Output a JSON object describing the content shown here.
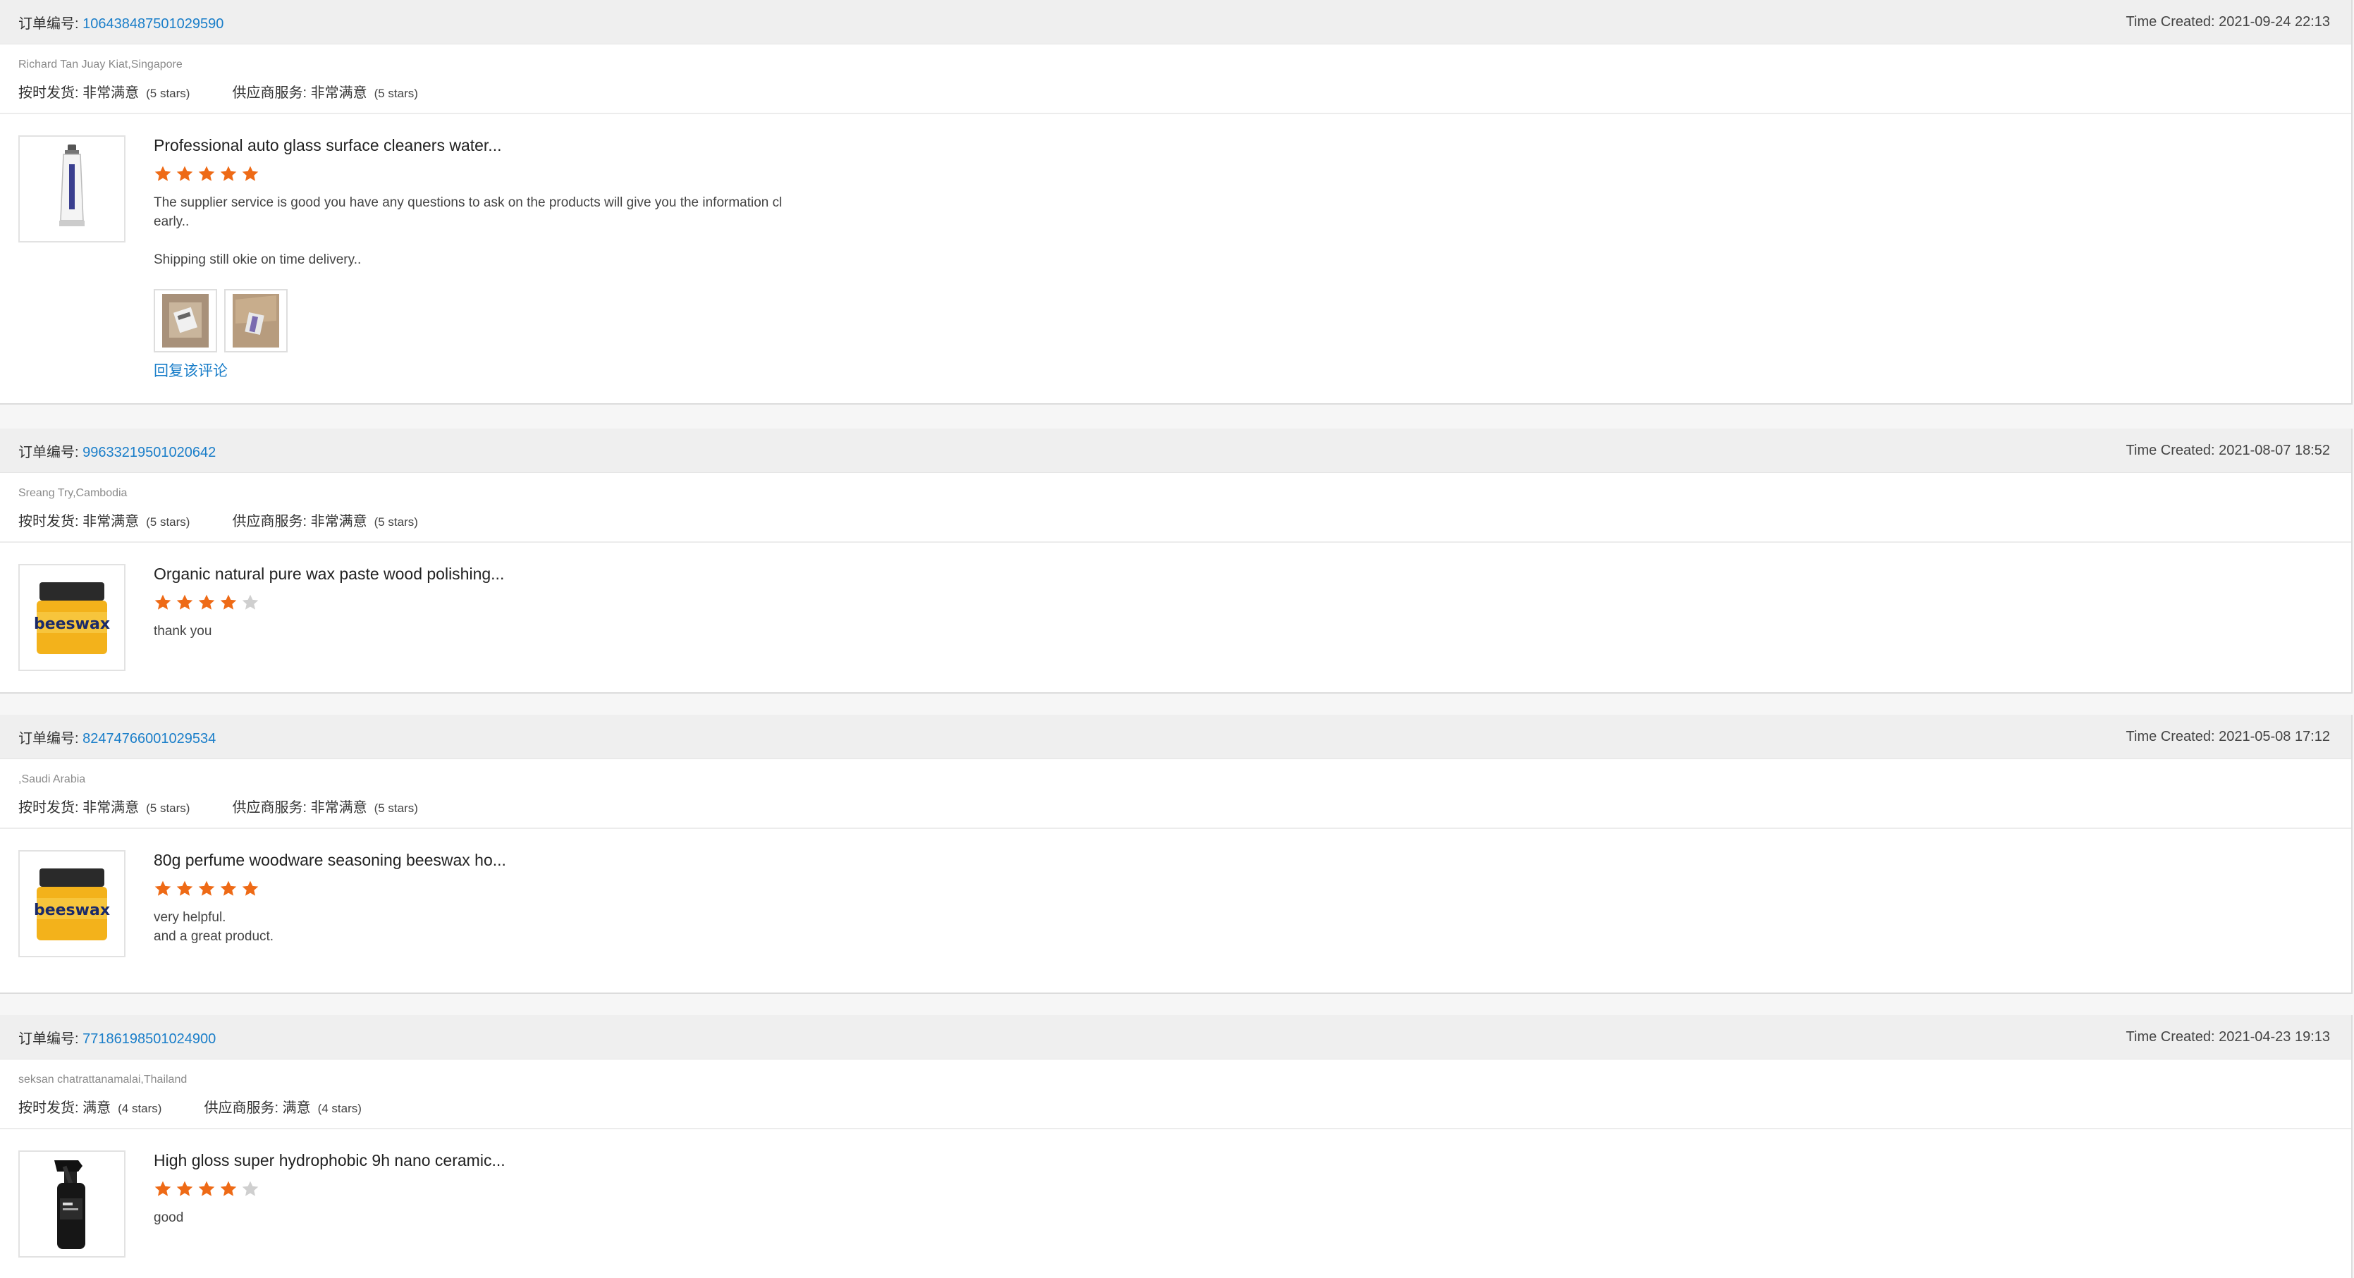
{
  "labels": {
    "order_no": "订单编号:",
    "on_time": "按时发货:",
    "supplier_service": "供应商服务:",
    "time_created": "Time Created:"
  },
  "colors": {
    "link": "#1a7ec9",
    "star_filled": "#ee6a16",
    "star_empty": "#cfcfcf",
    "header_bg": "#efefef"
  },
  "reviews": [
    {
      "order_number": "106438487501029590",
      "time_created": "2021-09-24 22:13",
      "buyer": "Richard Tan Juay Kiat,Singapore",
      "on_time_value": "非常满意",
      "on_time_stars": "(5 stars)",
      "service_value": "非常满意",
      "service_stars": "(5 stars)",
      "product_title": "Professional auto glass surface cleaners water...",
      "product_image": "tube-icon",
      "rating": 5,
      "comment_lines": [
        "The supplier service is good you have any questions to ask on the products will give you the information cl",
        "early..",
        "",
        "Shipping still okie on time delivery.."
      ],
      "photos": [
        "parcel-photo-icon",
        "parcel-photo-icon"
      ],
      "reply_label": "回复该评论"
    },
    {
      "order_number": "99633219501020642",
      "time_created": "2021-08-07 18:52",
      "buyer": "Sreang Try,Cambodia",
      "on_time_value": "非常满意",
      "on_time_stars": "(5 stars)",
      "service_value": "非常满意",
      "service_stars": "(5 stars)",
      "product_title": "Organic natural pure wax paste wood polishing...",
      "product_image": "beeswax-jar-icon",
      "product_image_text": "beeswax",
      "rating": 4,
      "comment_lines": [
        "thank you"
      ]
    },
    {
      "order_number": "82474766001029534",
      "time_created": "2021-05-08 17:12",
      "buyer": ",Saudi Arabia",
      "on_time_value": "非常满意",
      "on_time_stars": "(5 stars)",
      "service_value": "非常满意",
      "service_stars": "(5 stars)",
      "product_title": "80g perfume woodware seasoning beeswax ho...",
      "product_image": "beeswax-jar-icon",
      "product_image_text": "beeswax",
      "rating": 5,
      "comment_lines": [
        "very helpful.",
        "and a great product."
      ]
    },
    {
      "order_number": "77186198501024900",
      "time_created": "2021-04-23 19:13",
      "buyer": "seksan chatrattanamalai,Thailand",
      "on_time_value": "满意",
      "on_time_stars": "(4 stars)",
      "service_value": "满意",
      "service_stars": "(4 stars)",
      "product_title": "High gloss super hydrophobic 9h nano ceramic...",
      "product_image": "spray-bottle-icon",
      "rating": 4,
      "comment_lines": [
        "good"
      ]
    }
  ]
}
